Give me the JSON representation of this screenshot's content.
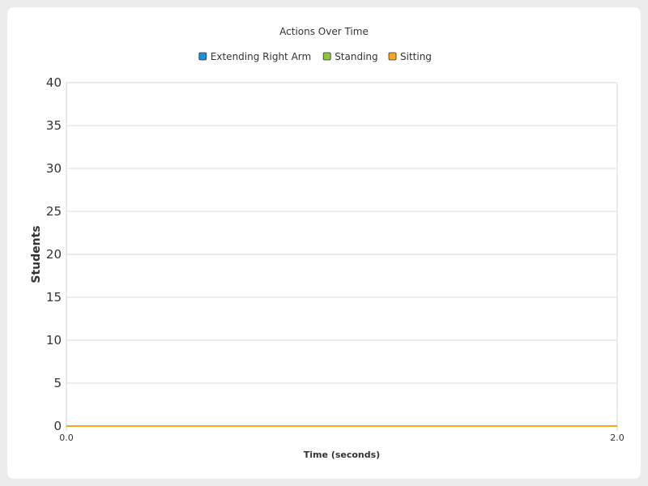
{
  "chart_data": {
    "type": "line",
    "title": "Actions Over Time",
    "xlabel": "Time (seconds)",
    "ylabel": "Students",
    "xlim": [
      0.0,
      2.0
    ],
    "ylim": [
      0,
      40
    ],
    "yticks": [
      0,
      5,
      10,
      15,
      20,
      25,
      30,
      35,
      40
    ],
    "xtick_labels": [
      "0.0",
      "2.0"
    ],
    "grid": true,
    "legend_position": "top",
    "x": [
      0.0,
      0.034,
      0.068,
      0.102,
      0.136,
      0.17,
      0.204,
      0.238,
      0.272,
      0.306,
      0.34,
      0.374,
      0.408,
      0.442,
      0.476,
      0.51,
      0.544,
      0.578,
      0.612,
      0.646,
      0.68,
      0.714,
      0.748,
      0.782,
      0.816,
      0.85,
      0.884,
      0.918,
      0.952,
      0.986,
      1.02,
      1.054,
      1.088,
      1.122,
      1.156,
      1.19,
      1.224,
      1.258,
      1.292,
      1.326,
      1.36,
      1.394,
      1.428,
      1.462,
      1.496,
      1.53,
      1.564,
      1.598,
      1.632,
      1.666,
      1.7,
      1.734,
      1.768,
      1.802,
      1.836,
      1.87,
      1.904,
      1.938,
      1.972,
      2.0
    ],
    "series": [
      {
        "name": "Extending Right Arm",
        "color": "#1f8fd6",
        "values": [
          0,
          0,
          0,
          0,
          0,
          0,
          0,
          0,
          0,
          0,
          0,
          0,
          0,
          0,
          0,
          0,
          0,
          0,
          0,
          0,
          0,
          0,
          0,
          0,
          0,
          0,
          0,
          0,
          0,
          0,
          0,
          0,
          0,
          0,
          0,
          0,
          0,
          0,
          0,
          0,
          0,
          0,
          0,
          0,
          0,
          0,
          0,
          0,
          0,
          0,
          0,
          0,
          0,
          0,
          0,
          0,
          0,
          0,
          0,
          0
        ]
      },
      {
        "name": "Standing",
        "color": "#8dc63f",
        "values": [
          0,
          0,
          0,
          0,
          0,
          0,
          0,
          0,
          0,
          0,
          0,
          0,
          0,
          0,
          0,
          0,
          0,
          0,
          0,
          0,
          0,
          0,
          0,
          0,
          0,
          0,
          0,
          0,
          0,
          0,
          0,
          0,
          0,
          0,
          0,
          0,
          0,
          0,
          0,
          0,
          0,
          0,
          0,
          0,
          0,
          0,
          0,
          0,
          0,
          0,
          0,
          0,
          0,
          0,
          0,
          0,
          0,
          0,
          0,
          0
        ]
      },
      {
        "name": "Sitting",
        "color": "#f5a623",
        "values": [
          0,
          0,
          0,
          0,
          0,
          0,
          0,
          0,
          0,
          0,
          0,
          0,
          0,
          0,
          0,
          0,
          0,
          0,
          0,
          0,
          0,
          0,
          0,
          0,
          0,
          0,
          0,
          0,
          0,
          0,
          0,
          0,
          0,
          0,
          0,
          0,
          0,
          0,
          0,
          0,
          0,
          0,
          0,
          0,
          0,
          0,
          0,
          0,
          0,
          0,
          0,
          0,
          0,
          0,
          0,
          0,
          0,
          0,
          0,
          0
        ]
      }
    ]
  }
}
